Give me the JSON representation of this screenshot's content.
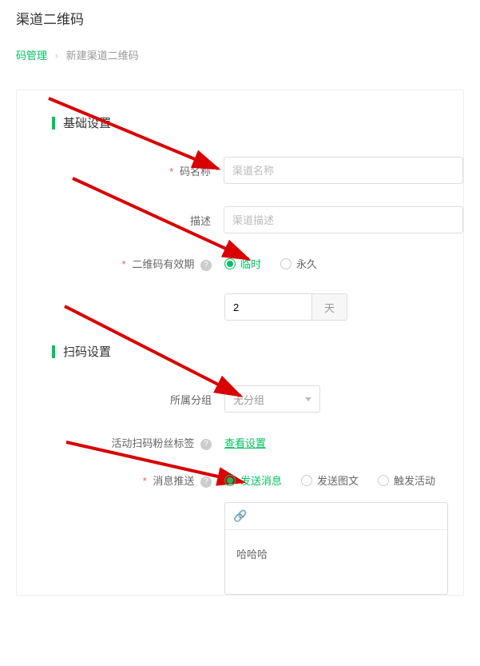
{
  "page": {
    "title": "渠道二维码"
  },
  "breadcrumb": {
    "parent": "码管理",
    "current": "新建渠道二维码"
  },
  "sections": {
    "basic": "基础设置",
    "scan": "扫码设置"
  },
  "labels": {
    "codeName": "码名称",
    "description": "描述",
    "validity": "二维码有效期",
    "group": "所属分组",
    "fanTag": "活动扫码粉丝标签",
    "msgPush": "消息推送"
  },
  "placeholders": {
    "codeName": "渠道名称",
    "description": "渠道描述"
  },
  "validity": {
    "temporary": "临时",
    "permanent": "永久",
    "value": "2",
    "unit": "天"
  },
  "group": {
    "selected": "无分组"
  },
  "fanTag": {
    "link": "查看设置"
  },
  "msgPush": {
    "sendMsg": "发送消息",
    "sendImgText": "发送图文",
    "triggerActivity": "触发活动"
  },
  "editor": {
    "content": "哈哈哈"
  }
}
